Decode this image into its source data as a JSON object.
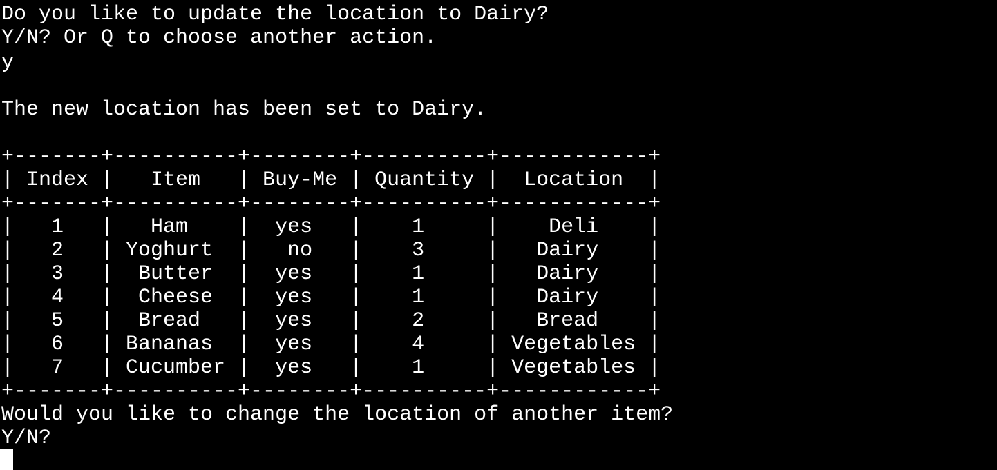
{
  "terminal": {
    "prompt_line_1": "Do you like to update the location to Dairy?",
    "prompt_line_2": "Y/N? Or Q to choose another action.",
    "user_input": "y",
    "confirmation": "The new location has been set to Dairy.",
    "table": {
      "border": "+-------+----------+--------+----------+------------+",
      "header": "| Index |   Item   | Buy-Me | Quantity |  Location  |",
      "rows": [
        "|   1   |   Ham    |  yes   |    1     |    Deli    |",
        "|   2   | Yoghurt  |   no   |    3     |   Dairy    |",
        "|   3   |  Butter  |  yes   |    1     |   Dairy    |",
        "|   4   |  Cheese  |  yes   |    1     |   Dairy    |",
        "|   5   |  Bread   |  yes   |    2     |   Bread    |",
        "|   6   | Bananas  |  yes   |    4     | Vegetables |",
        "|   7   | Cucumber |  yes   |    1     | Vegetables |"
      ]
    },
    "followup_question": "Would you like to change the location of another item?",
    "followup_prompt": "Y/N?"
  }
}
